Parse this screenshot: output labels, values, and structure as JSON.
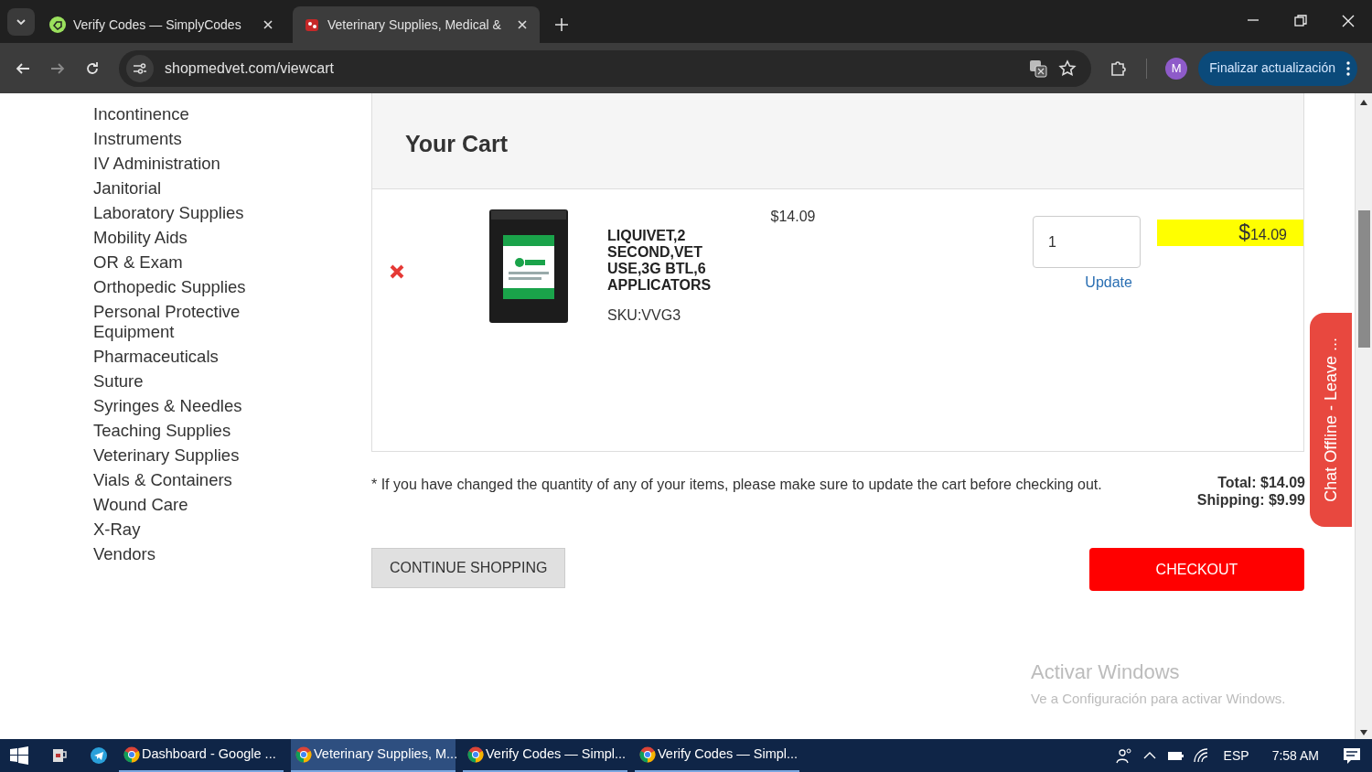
{
  "browser": {
    "tabs": [
      {
        "title": "Verify Codes — SimplyCodes",
        "selected": false,
        "kind": "coupon"
      },
      {
        "title": "Veterinary Supplies, Medical & ",
        "selected": true,
        "kind": "shop"
      }
    ],
    "url": "shopmedvet.com/viewcart",
    "profile_initial": "M",
    "update_button": "Finalizar actualización"
  },
  "sidebar": {
    "items": [
      "Incontinence",
      "Instruments",
      "IV Administration",
      "Janitorial",
      "Laboratory Supplies",
      "Mobility Aids",
      "OR & Exam",
      "Orthopedic Supplies",
      "Personal Protective Equipment",
      "Pharmaceuticals",
      "Suture",
      "Syringes & Needles",
      "Teaching Supplies",
      "Veterinary Supplies",
      "Vials & Containers",
      "Wound Care",
      "X-Ray",
      "Vendors"
    ]
  },
  "cart": {
    "title": "Your Cart",
    "items": [
      {
        "name": "LIQUIVET,2 SECOND,VET USE,3G BTL,6 APPLICATORS",
        "sku": "SKU:VVG3",
        "price": "$14.09",
        "quantity": "1",
        "update": "Update",
        "line_total_symbol": "$",
        "line_total": "14.09"
      }
    ],
    "note": "* If you have changed the quantity of any of your items, please make sure to update the cart before checking out.",
    "total": "Total: $14.09",
    "shipping": "Shipping: $9.99",
    "continue_button": "CONTINUE SHOPPING",
    "checkout_button": "CHECKOUT"
  },
  "chat_tab": "Chat Offline - Leave ...",
  "activation": {
    "title": "Activar Windows",
    "subtitle": "Ve a Configuración para activar Windows."
  },
  "taskbar": {
    "items": [
      {
        "label": "Dashboard - Google ...",
        "selected": false
      },
      {
        "label": "Veterinary Supplies, M...",
        "selected": true
      },
      {
        "label": "Verify Codes — Simpl...",
        "selected": false
      },
      {
        "label": "Verify Codes — Simpl...",
        "selected": false
      }
    ],
    "language": "ESP",
    "time": "7:58 AM"
  }
}
